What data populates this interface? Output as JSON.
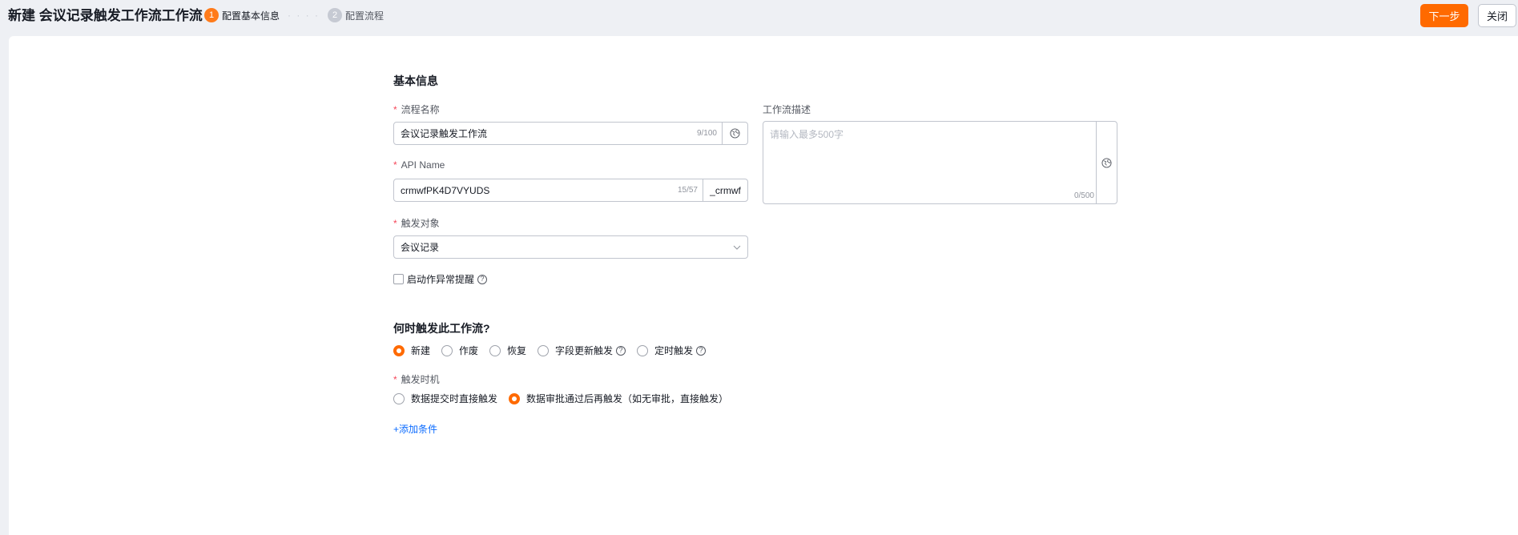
{
  "header": {
    "title": "新建 会议记录触发工作流工作流",
    "steps": [
      {
        "num": "1",
        "label": "配置基本信息"
      },
      {
        "num": "2",
        "label": "配置流程"
      }
    ],
    "step_separator": "· · · ·",
    "next_button": "下一步",
    "close_button": "关闭"
  },
  "basic_info": {
    "section_title": "基本信息",
    "required_mark": "*",
    "flow_name": {
      "label": "流程名称",
      "value": "会议记录触发工作流",
      "count": "9/100"
    },
    "api_name": {
      "label": "API Name",
      "value": "crmwfPK4D7VYUDS",
      "count": "15/57",
      "suffix": "_crmwf"
    },
    "trigger_object": {
      "label": "触发对象",
      "value": "会议记录"
    },
    "description": {
      "label": "工作流描述",
      "placeholder": "请输入最多500字",
      "count": "0/500"
    },
    "exception_alert": {
      "label": "启动作异常提醒",
      "checked": false
    }
  },
  "trigger": {
    "section_title": "何时触发此工作流?",
    "options": [
      {
        "label": "新建",
        "checked": true,
        "help": false
      },
      {
        "label": "作废",
        "checked": false,
        "help": false
      },
      {
        "label": "恢复",
        "checked": false,
        "help": false
      },
      {
        "label": "字段更新触发",
        "checked": false,
        "help": true
      },
      {
        "label": "定时触发",
        "checked": false,
        "help": true
      }
    ],
    "timing": {
      "label": "触发时机",
      "options": [
        {
          "label": "数据提交时直接触发",
          "checked": false
        },
        {
          "label": "数据审批通过后再触发（如无审批，直接触发）",
          "checked": true
        }
      ]
    },
    "add_condition": "+添加条件"
  },
  "colors": {
    "accent": "#ff6a00",
    "link": "#0c6cff",
    "required": "#f5475a"
  },
  "icons": {
    "help": "question-circle-icon",
    "translate": "globe-icon",
    "dropdown": "chevron-down-icon"
  }
}
